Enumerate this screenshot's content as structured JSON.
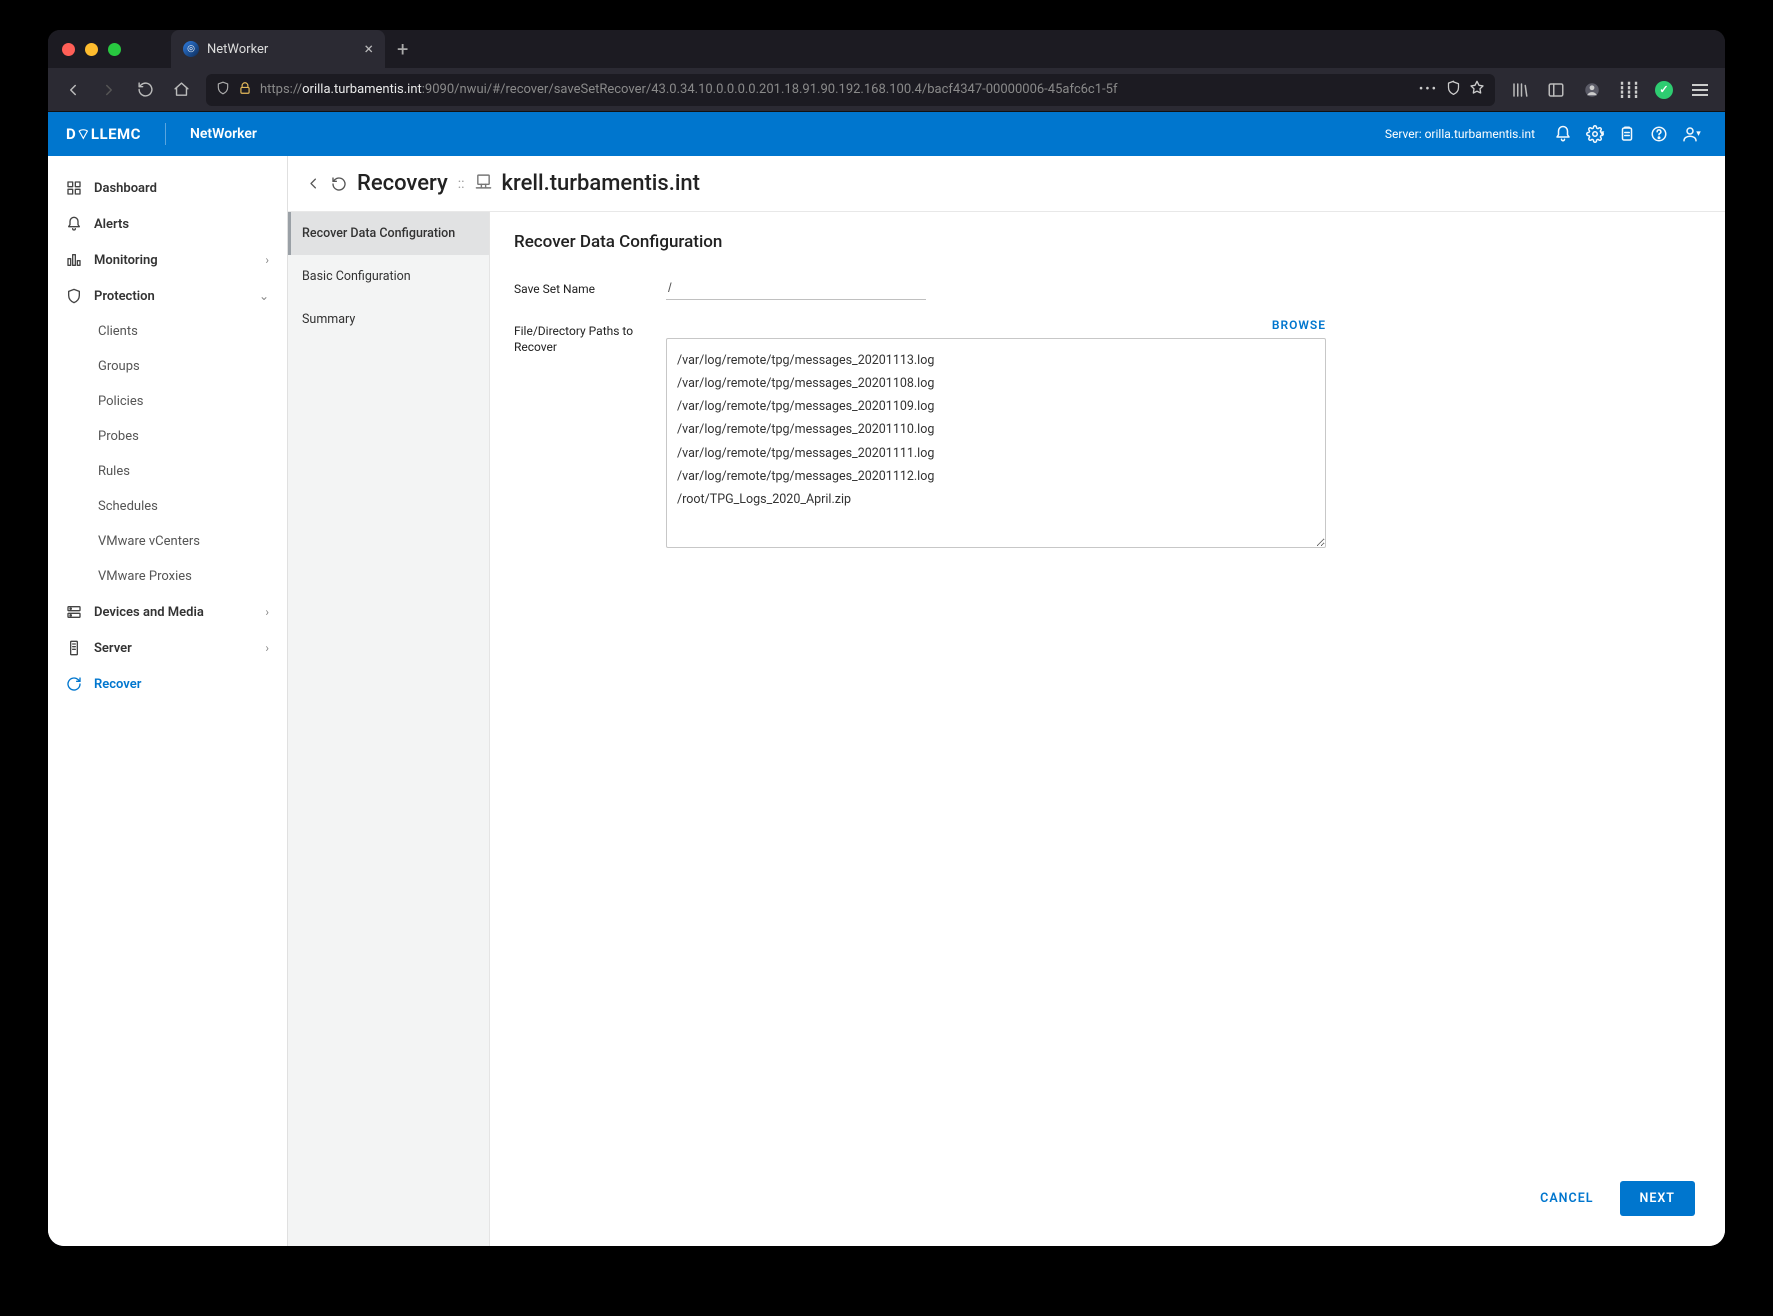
{
  "browser": {
    "tab_title": "NetWorker",
    "url_proto": "https://",
    "url_host": "orilla.turbamentis.int",
    "url_rest": ":9090/nwui/#/recover/saveSetRecover/43.0.34.10.0.0.0.0.201.18.91.90.192.168.100.4/bacf4347-00000006-45afc6c1-5f"
  },
  "header": {
    "brand_logo": "D⌔LLEMC",
    "product": "NetWorker",
    "server_label": "Server: orilla.turbamentis.int"
  },
  "sidebar": [
    {
      "key": "dashboard",
      "label": "Dashboard",
      "icon": "dashboard",
      "expand": ""
    },
    {
      "key": "alerts",
      "label": "Alerts",
      "icon": "bell",
      "expand": ""
    },
    {
      "key": "monitoring",
      "label": "Monitoring",
      "icon": "monitor",
      "expand": "›"
    },
    {
      "key": "protection",
      "label": "Protection",
      "icon": "shield",
      "expand": "⌄"
    },
    {
      "key": "clients",
      "label": "Clients",
      "sub": true
    },
    {
      "key": "groups",
      "label": "Groups",
      "sub": true
    },
    {
      "key": "policies",
      "label": "Policies",
      "sub": true
    },
    {
      "key": "probes",
      "label": "Probes",
      "sub": true
    },
    {
      "key": "rules",
      "label": "Rules",
      "sub": true
    },
    {
      "key": "schedules",
      "label": "Schedules",
      "sub": true
    },
    {
      "key": "vmware-vcenters",
      "label": "VMware vCenters",
      "sub": true
    },
    {
      "key": "vmware-proxies",
      "label": "VMware Proxies",
      "sub": true
    },
    {
      "key": "devices",
      "label": "Devices and Media",
      "icon": "devices",
      "expand": "›"
    },
    {
      "key": "server",
      "label": "Server",
      "icon": "server",
      "expand": "›"
    },
    {
      "key": "recover",
      "label": "Recover",
      "icon": "refresh",
      "active": true
    }
  ],
  "crumbs": {
    "section": "Recovery",
    "sep": "::",
    "host": "krell.turbamentis.int"
  },
  "steps": [
    {
      "key": "recover-data-config",
      "label": "Recover Data Configuration",
      "active": true
    },
    {
      "key": "basic-config",
      "label": "Basic Configuration"
    },
    {
      "key": "summary",
      "label": "Summary"
    }
  ],
  "form": {
    "title": "Recover Data Configuration",
    "save_set_label": "Save Set Name",
    "save_set_value": "/",
    "paths_label": "File/Directory Paths to Recover",
    "browse_label": "BROWSE",
    "paths_value": "/var/log/remote/tpg/messages_20201113.log\n/var/log/remote/tpg/messages_20201108.log\n/var/log/remote/tpg/messages_20201109.log\n/var/log/remote/tpg/messages_20201110.log\n/var/log/remote/tpg/messages_20201111.log\n/var/log/remote/tpg/messages_20201112.log\n/root/TPG_Logs_2020_April.zip"
  },
  "footer": {
    "cancel": "CANCEL",
    "next": "NEXT"
  }
}
